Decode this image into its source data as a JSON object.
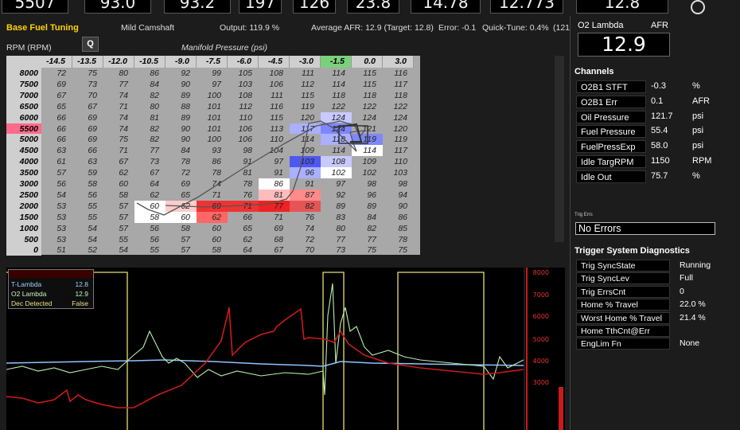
{
  "top_gauges": [
    "5507",
    "93.0",
    "93.2",
    "197",
    "126",
    "23.8",
    "14.78",
    "12.773",
    "12.8"
  ],
  "header": {
    "title": "Base Fuel Tuning",
    "q_button": "Q",
    "cam": "Mild Camshaft",
    "output": "Output: 119.9 %",
    "avg_afr": "Average AFR: 12.9 (Target: 12.8)",
    "error": "Error: -0.1",
    "quick_tune": "Quick-Tune: 0.4%",
    "trunc": "(121"
  },
  "lambda_box": {
    "label": "O2 Lambda",
    "unit": "AFR",
    "value": "12.9"
  },
  "table": {
    "y_axis_title": "RPM (RPM)",
    "x_axis_title": "Manifold Pressure (psi)",
    "columns": [
      "-14.5",
      "-13.5",
      "-12.0",
      "-10.5",
      "-9.0",
      "-7.5",
      "-6.0",
      "-4.5",
      "-3.0",
      "-1.5",
      "0.0",
      "3.0"
    ],
    "rows": [
      "8000",
      "7500",
      "7000",
      "6500",
      "6000",
      "5500",
      "5000",
      "4500",
      "4000",
      "3500",
      "3000",
      "2500",
      "2000",
      "1500",
      "1000",
      "500",
      "0"
    ],
    "values": [
      [
        72,
        75,
        80,
        86,
        92,
        99,
        105,
        108,
        111,
        114,
        115,
        116
      ],
      [
        69,
        73,
        77,
        84,
        90,
        97,
        103,
        106,
        112,
        114,
        115,
        117
      ],
      [
        67,
        70,
        74,
        82,
        89,
        100,
        108,
        111,
        115,
        118,
        118,
        118
      ],
      [
        65,
        67,
        71,
        80,
        88,
        101,
        112,
        116,
        119,
        122,
        122,
        122
      ],
      [
        66,
        69,
        74,
        81,
        89,
        101,
        110,
        115,
        120,
        124,
        124,
        124
      ],
      [
        66,
        69,
        74,
        82,
        90,
        101,
        106,
        113,
        117,
        124,
        121,
        120
      ],
      [
        66,
        69,
        75,
        82,
        90,
        100,
        106,
        110,
        114,
        118,
        119,
        119
      ],
      [
        63,
        66,
        71,
        77,
        84,
        93,
        98,
        104,
        109,
        114,
        114,
        117
      ],
      [
        61,
        63,
        67,
        73,
        78,
        86,
        91,
        97,
        103,
        108,
        109,
        110
      ],
      [
        57,
        59,
        62,
        67,
        72,
        78,
        81,
        91,
        96,
        102,
        102,
        103
      ],
      [
        56,
        58,
        60,
        64,
        69,
        74,
        78,
        86,
        91,
        97,
        98,
        98
      ],
      [
        54,
        56,
        58,
        62,
        65,
        71,
        76,
        81,
        87,
        92,
        96,
        94
      ],
      [
        53,
        55,
        57,
        60,
        62,
        69,
        71,
        77,
        82,
        89,
        89,
        90
      ],
      [
        53,
        55,
        57,
        58,
        60,
        62,
        66,
        71,
        76,
        83,
        84,
        86
      ],
      [
        53,
        54,
        57,
        56,
        58,
        60,
        65,
        69,
        74,
        80,
        82,
        85
      ],
      [
        53,
        54,
        55,
        56,
        57,
        60,
        62,
        68,
        72,
        77,
        77,
        78
      ],
      [
        51,
        52,
        54,
        55,
        57,
        58,
        64,
        67,
        70,
        73,
        75,
        75
      ]
    ]
  },
  "channels": {
    "title": "Channels",
    "items": [
      {
        "name": "O2B1 STFT",
        "value": "-0.3",
        "unit": "%"
      },
      {
        "name": "O2B1 Err",
        "value": "0.1",
        "unit": "AFR"
      },
      {
        "name": "Oil Pressure",
        "value": "121.7",
        "unit": "psi"
      },
      {
        "name": "Fuel Pressure",
        "value": "55.4",
        "unit": "psi"
      },
      {
        "name": "FuelPressExp",
        "value": "58.0",
        "unit": "psi"
      },
      {
        "name": "Idle TargRPM",
        "value": "1150",
        "unit": "RPM"
      },
      {
        "name": "Idle Out",
        "value": "75.7",
        "unit": "%"
      }
    ]
  },
  "trig_errs": {
    "label": "Trig Errs",
    "value": "No Errors"
  },
  "trigger_diag": {
    "title": "Trigger System Diagnostics",
    "items": [
      {
        "name": "Trig SyncState",
        "value": "Running"
      },
      {
        "name": "Trig SyncLev",
        "value": "Full"
      },
      {
        "name": "Trig ErrsCnt",
        "value": "0"
      },
      {
        "name": "Home % Travel",
        "value": "22.0  %"
      },
      {
        "name": "Worst Home % Travel",
        "value": "21.4  %"
      },
      {
        "name": "Home TthCnt@Err",
        "value": ""
      },
      {
        "name": "EngLim Fn",
        "value": "None"
      }
    ]
  },
  "chart_legend": [
    {
      "name": "T-Lambda",
      "value": "12.8",
      "color": "#9fd0ff"
    },
    {
      "name": "O2 Lambda",
      "value": "12.9",
      "color": "#c8f5c0"
    },
    {
      "name": "Dec Detected",
      "value": "False",
      "color": "#e8e08a"
    }
  ],
  "chart_axis_ticks": [
    "8000",
    "7000",
    "6000",
    "5000",
    "4000",
    "3000"
  ],
  "colors": {
    "accent_yellow": "#ffd200",
    "rpm_highlight": "#ff6b8a",
    "trace_red": "#cc1a1a",
    "trace_green": "#b8f0b0",
    "trace_blue": "#8fc3ff"
  }
}
